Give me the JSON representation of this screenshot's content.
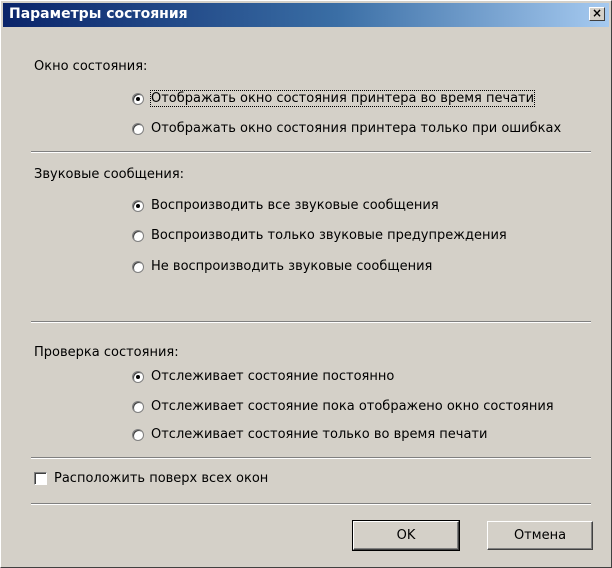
{
  "window": {
    "title": "Параметры состояния",
    "close_glyph": "×"
  },
  "status_window": {
    "label": "Окно состояния:",
    "options": [
      {
        "label": "Отображать окно состояния принтера во время печати",
        "selected": true
      },
      {
        "label": "Отображать окно состояния принтера только при ошибках",
        "selected": false
      }
    ]
  },
  "sounds": {
    "label": "Звуковые сообщения:",
    "options": [
      {
        "label": "Воспроизводить все звуковые сообщения",
        "selected": true
      },
      {
        "label": "Воспроизводить только звуковые предупреждения",
        "selected": false
      },
      {
        "label": "Не воспроизводить звуковые сообщения",
        "selected": false
      }
    ]
  },
  "monitoring": {
    "label": "Проверка состояния:",
    "options": [
      {
        "label": "Отслеживает состояние постоянно",
        "selected": true
      },
      {
        "label": "Отслеживает состояние пока отображено окно состояния",
        "selected": false
      },
      {
        "label": "Отслеживает состояние только во время печати",
        "selected": false
      }
    ]
  },
  "always_on_top": {
    "label": "Расположить поверх всех окон",
    "checked": false
  },
  "buttons": {
    "ok": "OK",
    "cancel": "Отмена"
  }
}
